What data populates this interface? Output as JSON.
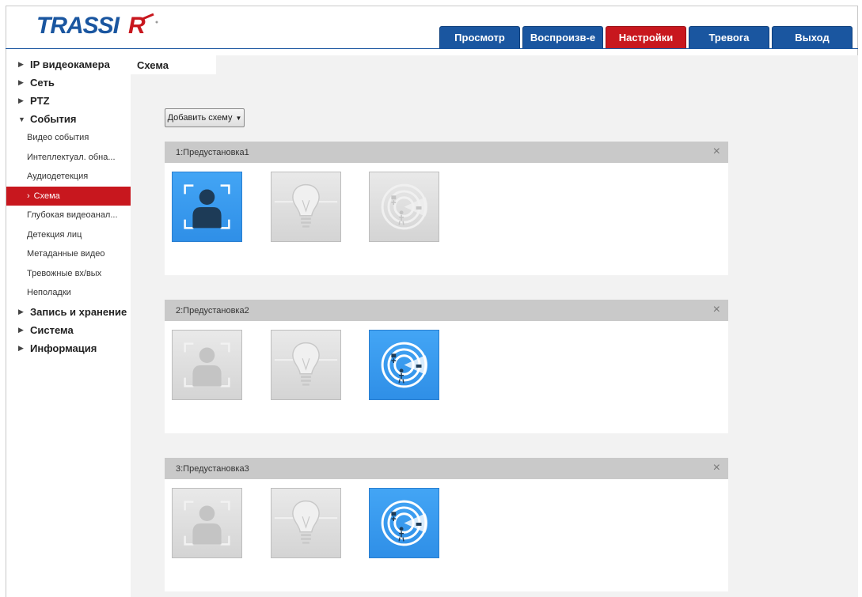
{
  "brand": {
    "logo_text": "TRASSIR"
  },
  "top_tabs": [
    {
      "label": "Просмотр",
      "active": false
    },
    {
      "label": "Воспроизв-е",
      "active": false
    },
    {
      "label": "Настройки",
      "active": true
    },
    {
      "label": "Тревога",
      "active": false
    },
    {
      "label": "Выход",
      "active": false
    }
  ],
  "sidebar": {
    "groups_before": [
      {
        "label": "IP видеокамера",
        "expanded": false
      },
      {
        "label": "Сеть",
        "expanded": false
      },
      {
        "label": "PTZ",
        "expanded": false
      },
      {
        "label": "События",
        "expanded": true
      }
    ],
    "sub_items": [
      {
        "label": "Видео события"
      },
      {
        "label": "Интеллектуал. обна..."
      },
      {
        "label": "Аудиодетекция"
      },
      {
        "label": "Схема",
        "active": true
      },
      {
        "label": "Глубокая видеоанал..."
      },
      {
        "label": "Детекция лиц"
      },
      {
        "label": "Метаданные видео"
      },
      {
        "label": "Тревожные вх/вых"
      },
      {
        "label": "Неполадки"
      }
    ],
    "groups_after": [
      {
        "label": "Запись и хранение",
        "expanded": false
      },
      {
        "label": "Система",
        "expanded": false
      },
      {
        "label": "Информация",
        "expanded": false
      }
    ]
  },
  "page": {
    "tab_label": "Схема",
    "add_button_label": "Добавить схему",
    "schemes": [
      {
        "title": "1:Предустановка1",
        "close": "×",
        "tiles": [
          "face-detection",
          "light-bulb",
          "radar-intrusion"
        ],
        "active": [
          true,
          false,
          false
        ]
      },
      {
        "title": "2:Предустановка2",
        "close": "×",
        "tiles": [
          "face-detection",
          "light-bulb",
          "radar-intrusion"
        ],
        "active": [
          false,
          false,
          true
        ]
      },
      {
        "title": "3:Предустановка3",
        "close": "×",
        "tiles": [
          "face-detection",
          "light-bulb",
          "radar-intrusion"
        ],
        "active": [
          false,
          false,
          true
        ]
      }
    ]
  },
  "colors": {
    "primary_blue": "#1a56a0",
    "accent_red": "#c8171e",
    "tile_active": "#3a9af0",
    "tile_inactive": "#dcdcdc"
  }
}
